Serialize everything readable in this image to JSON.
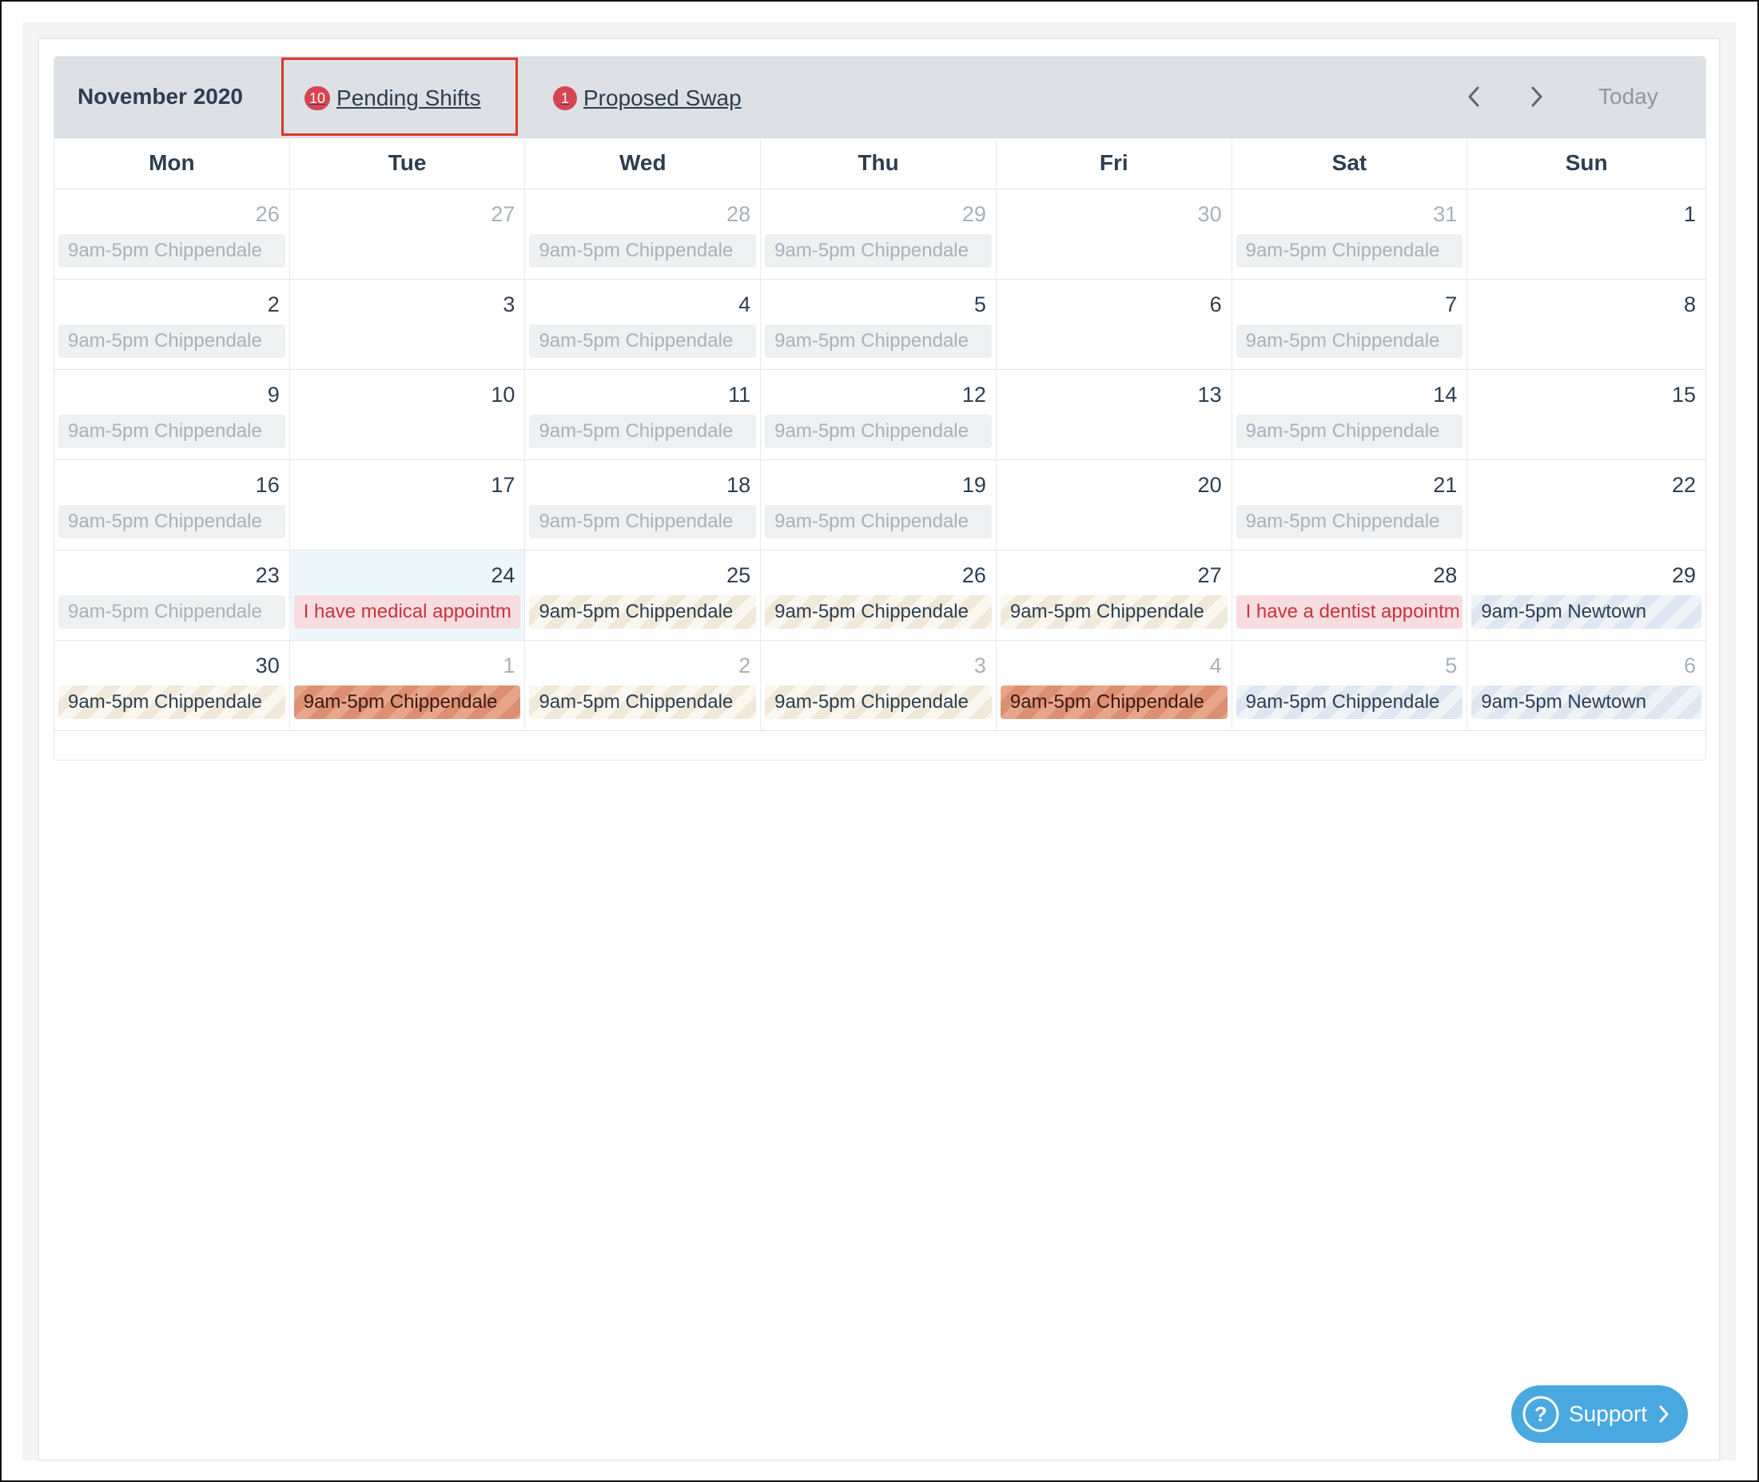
{
  "header": {
    "month_title": "November 2020",
    "pending": {
      "count": "10",
      "label": "Pending Shifts"
    },
    "swap": {
      "count": "1",
      "label": "Proposed Swap"
    },
    "today_label": "Today"
  },
  "weekdays": [
    "Mon",
    "Tue",
    "Wed",
    "Thu",
    "Fri",
    "Sat",
    "Sun"
  ],
  "weeks": [
    [
      {
        "day": "26",
        "other": true,
        "event": {
          "text": "9am-5pm Chippendale",
          "kind": "past"
        }
      },
      {
        "day": "27",
        "other": true
      },
      {
        "day": "28",
        "other": true,
        "event": {
          "text": "9am-5pm Chippendale",
          "kind": "past"
        }
      },
      {
        "day": "29",
        "other": true,
        "event": {
          "text": "9am-5pm Chippendale",
          "kind": "past"
        }
      },
      {
        "day": "30",
        "other": true
      },
      {
        "day": "31",
        "other": true,
        "event": {
          "text": "9am-5pm Chippendale",
          "kind": "past"
        }
      },
      {
        "day": "1"
      }
    ],
    [
      {
        "day": "2",
        "event": {
          "text": "9am-5pm Chippendale",
          "kind": "past"
        }
      },
      {
        "day": "3"
      },
      {
        "day": "4",
        "event": {
          "text": "9am-5pm Chippendale",
          "kind": "past"
        }
      },
      {
        "day": "5",
        "event": {
          "text": "9am-5pm Chippendale",
          "kind": "past"
        }
      },
      {
        "day": "6"
      },
      {
        "day": "7",
        "event": {
          "text": "9am-5pm Chippendale",
          "kind": "past"
        }
      },
      {
        "day": "8"
      }
    ],
    [
      {
        "day": "9",
        "event": {
          "text": "9am-5pm Chippendale",
          "kind": "past"
        }
      },
      {
        "day": "10"
      },
      {
        "day": "11",
        "event": {
          "text": "9am-5pm Chippendale",
          "kind": "past"
        }
      },
      {
        "day": "12",
        "event": {
          "text": "9am-5pm Chippendale",
          "kind": "past"
        }
      },
      {
        "day": "13"
      },
      {
        "day": "14",
        "event": {
          "text": "9am-5pm Chippendale",
          "kind": "past"
        }
      },
      {
        "day": "15"
      }
    ],
    [
      {
        "day": "16",
        "event": {
          "text": "9am-5pm Chippendale",
          "kind": "past"
        }
      },
      {
        "day": "17"
      },
      {
        "day": "18",
        "event": {
          "text": "9am-5pm Chippendale",
          "kind": "past"
        }
      },
      {
        "day": "19",
        "event": {
          "text": "9am-5pm Chippendale",
          "kind": "past"
        }
      },
      {
        "day": "20"
      },
      {
        "day": "21",
        "event": {
          "text": "9am-5pm Chippendale",
          "kind": "past"
        }
      },
      {
        "day": "22"
      }
    ],
    [
      {
        "day": "23",
        "event": {
          "text": "9am-5pm Chippendale",
          "kind": "past"
        }
      },
      {
        "day": "24",
        "today": true,
        "event": {
          "text": "I have medical appointm",
          "kind": "leave"
        }
      },
      {
        "day": "25",
        "event": {
          "text": "9am-5pm Chippendale",
          "kind": "pending"
        }
      },
      {
        "day": "26",
        "event": {
          "text": "9am-5pm Chippendale",
          "kind": "pending"
        }
      },
      {
        "day": "27",
        "event": {
          "text": "9am-5pm Chippendale",
          "kind": "pending"
        }
      },
      {
        "day": "28",
        "event": {
          "text": "I have a dentist appointm",
          "kind": "leave"
        }
      },
      {
        "day": "29",
        "event": {
          "text": "9am-5pm Newtown",
          "kind": "swap"
        }
      }
    ],
    [
      {
        "day": "30",
        "event": {
          "text": "9am-5pm Chippendale",
          "kind": "pending"
        }
      },
      {
        "day": "1",
        "other": true,
        "event": {
          "text": "9am-5pm Chippendale",
          "kind": "confirmed"
        }
      },
      {
        "day": "2",
        "other": true,
        "event": {
          "text": "9am-5pm Chippendale",
          "kind": "pending"
        }
      },
      {
        "day": "3",
        "other": true,
        "event": {
          "text": "9am-5pm Chippendale",
          "kind": "pending"
        }
      },
      {
        "day": "4",
        "other": true,
        "event": {
          "text": "9am-5pm Chippendale",
          "kind": "confirmed"
        }
      },
      {
        "day": "5",
        "other": true,
        "event": {
          "text": "9am-5pm Chippendale",
          "kind": "swap"
        }
      },
      {
        "day": "6",
        "other": true,
        "event": {
          "text": "9am-5pm Newtown",
          "kind": "swap"
        }
      }
    ]
  ],
  "support": {
    "label": "Support",
    "icon": "question-circle-icon"
  },
  "colors": {
    "header_bg": "#dde1e6",
    "badge": "#d64550",
    "highlight_border": "#d93a22",
    "support": "#4aa8e0",
    "leave_text": "#c7333d"
  }
}
